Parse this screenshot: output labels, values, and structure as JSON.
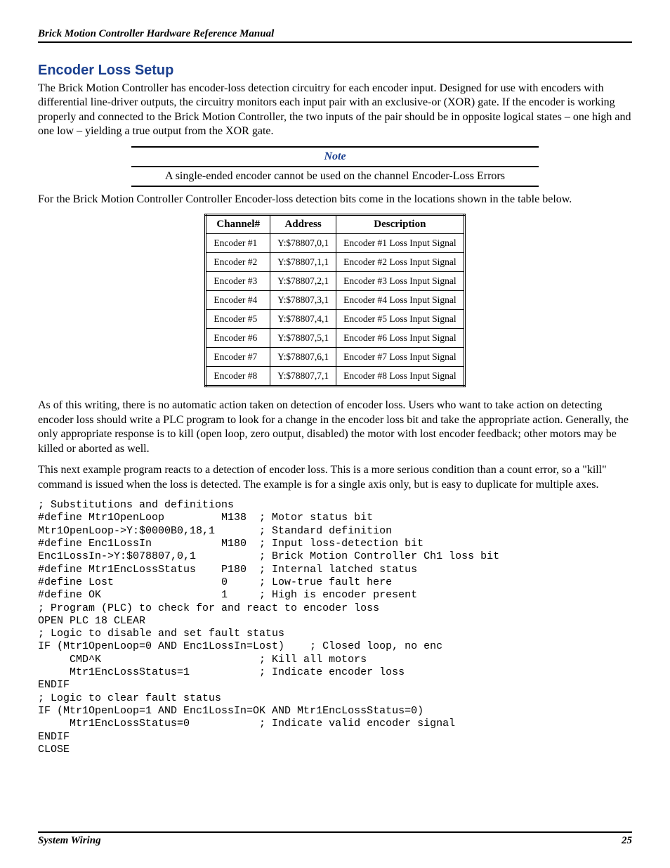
{
  "header": "Brick Motion Controller Hardware Reference Manual",
  "section_title": "Encoder Loss Setup",
  "para1": "The Brick Motion Controller has encoder-loss detection circuitry for each encoder input.  Designed for use with encoders with differential line-driver outputs, the circuitry monitors each input pair with an exclusive-or (XOR) gate.  If the encoder is working properly and connected to the Brick Motion Controller, the two inputs of the pair should be in opposite logical states – one high and one low – yielding a true output from the XOR gate.",
  "note_title": "Note",
  "note_text": "A single-ended encoder cannot be used on the channel Encoder-Loss Errors",
  "para2": "For the Brick Motion Controller Controller Encoder-loss detection bits come in the locations shown in the table below.",
  "table": {
    "headers": [
      "Channel#",
      "Address",
      "Description"
    ],
    "rows": [
      [
        "Encoder #1",
        "Y:$78807,0,1",
        "Encoder #1 Loss Input Signal"
      ],
      [
        "Encoder #2",
        "Y:$78807,1,1",
        "Encoder #2 Loss Input Signal"
      ],
      [
        "Encoder #3",
        "Y:$78807,2,1",
        "Encoder #3 Loss Input Signal"
      ],
      [
        "Encoder #4",
        "Y:$78807,3,1",
        "Encoder #4 Loss Input Signal"
      ],
      [
        "Encoder #5",
        "Y:$78807,4,1",
        "Encoder #5 Loss Input Signal"
      ],
      [
        "Encoder #6",
        "Y:$78807,5,1",
        "Encoder #6 Loss Input Signal"
      ],
      [
        "Encoder #7",
        "Y:$78807,6,1",
        "Encoder #7 Loss Input Signal"
      ],
      [
        "Encoder #8",
        "Y:$78807,7,1",
        "Encoder #8 Loss Input Signal"
      ]
    ]
  },
  "para3": "As of this writing, there is no automatic action taken on detection of encoder loss.  Users who want to take action on detecting encoder loss should write a PLC program to look for a change in the encoder loss bit and take the appropriate action.  Generally, the only appropriate response is to kill (open loop, zero output, disabled) the motor with lost encoder feedback; other motors may be killed or aborted as well.",
  "para4": "This next example program reacts to a detection of encoder loss.  This is a more serious condition than a count error, so a \"kill\" command is issued when the loss is detected. The example is for a single axis only, but is easy to duplicate for multiple axes.",
  "code": "; Substitutions and definitions\n#define Mtr1OpenLoop         M138  ; Motor status bit\nMtr1OpenLoop->Y:$0000B0,18,1       ; Standard definition\n#define Enc1LossIn           M180  ; Input loss-detection bit\nEnc1LossIn->Y:$078807,0,1          ; Brick Motion Controller Ch1 loss bit\n#define Mtr1EncLossStatus    P180  ; Internal latched status\n#define Lost                 0     ; Low-true fault here\n#define OK                   1     ; High is encoder present\n; Program (PLC) to check for and react to encoder loss\nOPEN PLC 18 CLEAR\n; Logic to disable and set fault status\nIF (Mtr1OpenLoop=0 AND Enc1LossIn=Lost)    ; Closed loop, no enc\n     CMD^K                         ; Kill all motors\n     Mtr1EncLossStatus=1           ; Indicate encoder loss\nENDIF\n; Logic to clear fault status\nIF (Mtr1OpenLoop=1 AND Enc1LossIn=OK AND Mtr1EncLossStatus=0)\n     Mtr1EncLossStatus=0           ; Indicate valid encoder signal\nENDIF\nCLOSE",
  "footer_left": "System Wiring",
  "footer_right": "25"
}
